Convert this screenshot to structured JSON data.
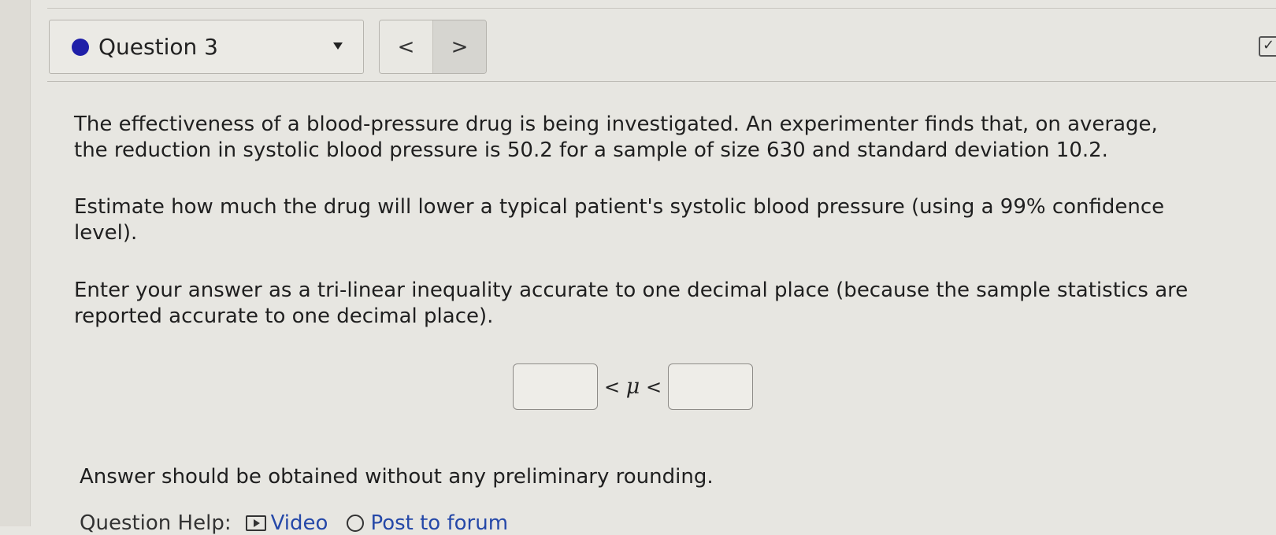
{
  "header": {
    "question_label": "Question 3",
    "status_color": "#1f1fa8",
    "dropdown_icon": "caret-down-icon",
    "prev_label": "<",
    "next_label": ">",
    "corner_icon": "checkbox-icon"
  },
  "problem": {
    "paragraph_1": "The effectiveness of a blood-pressure drug is being investigated. An experimenter finds that, on average, the reduction in systolic blood pressure is 50.2 for a sample of size 630 and standard deviation 10.2.",
    "paragraph_2": "Estimate how much the drug will lower a typical patient's systolic blood pressure (using a 99% confidence level).",
    "paragraph_3": "Enter your answer as a tri-linear inequality accurate to one decimal place (because the sample statistics are reported accurate to one decimal place)."
  },
  "answer": {
    "lower_value": "",
    "upper_value": "",
    "symbol_left": "<",
    "mu": "μ",
    "symbol_right": "<"
  },
  "note": "Answer should be obtained without any preliminary rounding.",
  "help": {
    "label": "Question Help:",
    "video_label": "Video",
    "forum_label": "Post to forum",
    "accent_color": "#2548a8"
  }
}
